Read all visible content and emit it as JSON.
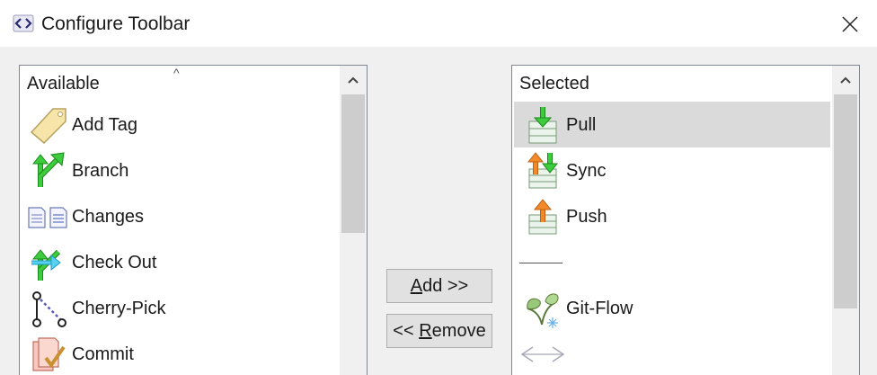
{
  "window": {
    "title": "Configure Toolbar"
  },
  "available": {
    "header": "Available",
    "items": [
      {
        "label": "Add Tag",
        "icon": "tag-icon"
      },
      {
        "label": "Branch",
        "icon": "branch-icon"
      },
      {
        "label": "Changes",
        "icon": "changes-icon"
      },
      {
        "label": "Check Out",
        "icon": "checkout-icon"
      },
      {
        "label": "Cherry-Pick",
        "icon": "cherry-pick-icon"
      },
      {
        "label": "Commit",
        "icon": "commit-icon"
      }
    ]
  },
  "selected": {
    "header": "Selected",
    "items": [
      {
        "label": "Pull",
        "icon": "pull-icon",
        "highlighted": true
      },
      {
        "label": "Sync",
        "icon": "sync-icon"
      },
      {
        "label": "Push",
        "icon": "push-icon"
      },
      {
        "label": "",
        "icon": "separator-line"
      },
      {
        "label": "Git-Flow",
        "icon": "git-flow-icon"
      },
      {
        "label": "",
        "icon": "code-brackets-icon"
      }
    ]
  },
  "buttons": {
    "add_access_key": "A",
    "add_rest": "dd >>",
    "remove_prefix": "<< ",
    "remove_access_key": "R",
    "remove_rest": "emove"
  },
  "colors": {
    "green_arrow": "#3dcc3d",
    "orange_arrow": "#f08a2a",
    "highlight": "#dadada",
    "dialog_bg": "#f0f0f0"
  }
}
